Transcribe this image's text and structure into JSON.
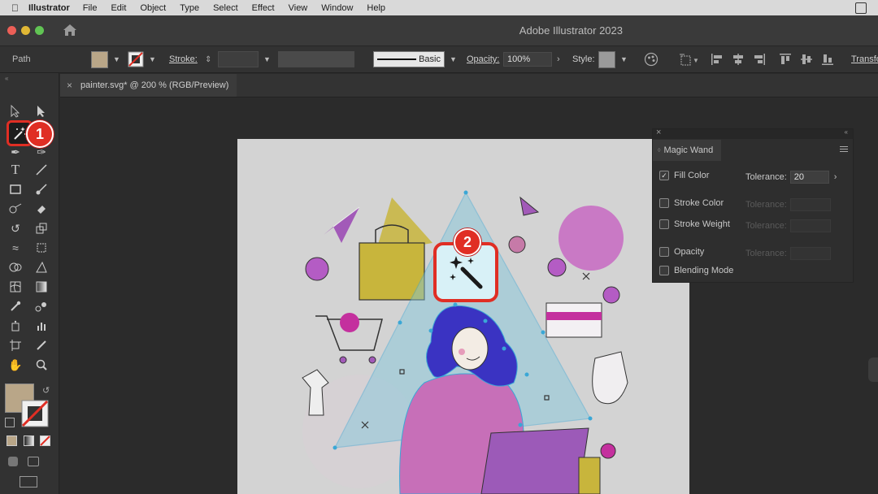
{
  "menubar": {
    "app": "Illustrator",
    "items": [
      "File",
      "Edit",
      "Object",
      "Type",
      "Select",
      "Effect",
      "View",
      "Window",
      "Help"
    ]
  },
  "titlebar": {
    "title": "Adobe Illustrator 2023"
  },
  "controlbar": {
    "selection": "Path",
    "stroke_label": "Stroke:",
    "brush_label": "Basic",
    "opacity_label": "Opacity:",
    "opacity_value": "100%",
    "style_label": "Style:",
    "transform_label": "Transfo"
  },
  "document_tab": {
    "close": "×",
    "title": "painter.svg* @ 200 % (RGB/Preview)"
  },
  "magic_wand_panel": {
    "title": "Magic Wand",
    "fill_color": {
      "label": "Fill Color",
      "checked": true,
      "tolerance_label": "Tolerance:",
      "tolerance_value": "20"
    },
    "stroke_color": {
      "label": "Stroke Color",
      "tolerance_label": "Tolerance:"
    },
    "stroke_weight": {
      "label": "Stroke Weight",
      "tolerance_label": "Tolerance:"
    },
    "opacity": {
      "label": "Opacity",
      "tolerance_label": "Tolerance:"
    },
    "blending_mode": {
      "label": "Blending Mode"
    }
  },
  "callouts": {
    "step1": "1",
    "step2": "2"
  },
  "colors": {
    "fill_swatch": "#b9a688",
    "accent_red": "#e02e24",
    "selection_blue": "#3aa7d6",
    "purple": "#b45cc4",
    "yellow": "#d8c23a"
  },
  "icons": [
    "apple-icon",
    "home-icon",
    "magic-wand-icon",
    "selection-icon",
    "direct-selection-icon",
    "pen-icon",
    "type-icon",
    "line-icon",
    "rectangle-icon",
    "paintbrush-icon",
    "eraser-icon",
    "rotate-icon",
    "scale-icon",
    "hand-icon",
    "zoom-icon",
    "eyedropper-icon",
    "artboard-icon",
    "graph-icon",
    "gradient-icon",
    "close-icon",
    "menu-icon"
  ]
}
